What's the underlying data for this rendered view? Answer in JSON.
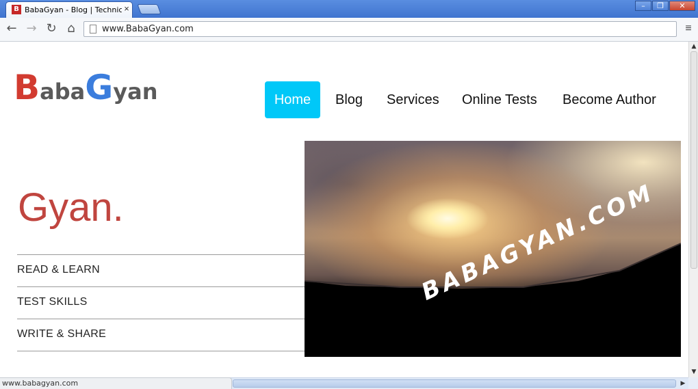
{
  "browser": {
    "tab_title": "BabaGyan - Blog | Technical ...",
    "tab_favicon_glyph": "B",
    "close_glyph": "×",
    "url": "www.BabaGyan.com",
    "status_url": "www.babagyan.com",
    "window_controls": {
      "minimize": "–",
      "restore": "❐",
      "close": "✕"
    },
    "nav_icons": {
      "back": "←",
      "forward": "→",
      "reload": "↻",
      "home": "⌂",
      "menu": "≡"
    }
  },
  "logo": {
    "letters": [
      {
        "char": "B",
        "color": "#d23b30",
        "size": "big"
      },
      {
        "char": "a",
        "color": "#5a5a5a",
        "size": "small"
      },
      {
        "char": "b",
        "color": "#5a5a5a",
        "size": "small"
      },
      {
        "char": "a",
        "color": "#5a5a5a",
        "size": "small"
      },
      {
        "char": "G",
        "color": "#3b7ddd",
        "size": "big"
      },
      {
        "char": "y",
        "color": "#5a5a5a",
        "size": "small"
      },
      {
        "char": "a",
        "color": "#5a5a5a",
        "size": "small"
      },
      {
        "char": "n",
        "color": "#5a5a5a",
        "size": "small"
      }
    ]
  },
  "nav": {
    "items": [
      {
        "label": "Home",
        "active": true
      },
      {
        "label": "Blog",
        "active": false
      },
      {
        "label": "Services",
        "active": false
      },
      {
        "label": "Online Tests",
        "active": false
      },
      {
        "label": "Become Author",
        "active": false
      }
    ],
    "active_color": "#00c8f8"
  },
  "hero": {
    "title": "Gyan.",
    "title_color": "#c0453f",
    "features": [
      "READ & LEARN",
      "TEST SKILLS",
      "WRITE & SHARE"
    ],
    "image_watermark": "BABAGYAN.COM"
  },
  "scroll_icons": {
    "up": "▲",
    "down": "▼",
    "left": "◀",
    "right": "▶"
  }
}
